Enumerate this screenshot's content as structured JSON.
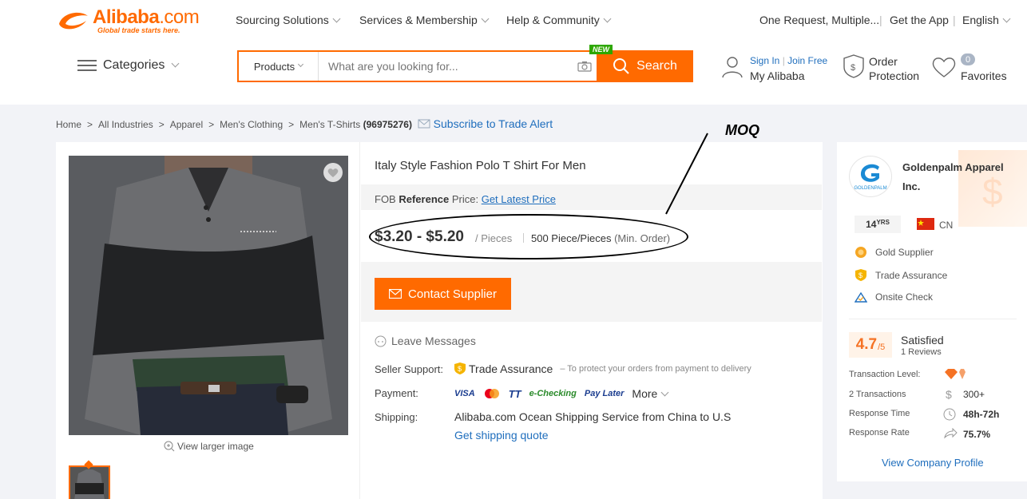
{
  "header": {
    "logo_word": "Alibaba",
    "logo_dotcom": ".com",
    "logo_tagline": "Global trade starts here.",
    "nav": [
      "Sourcing Solutions",
      "Services & Membership",
      "Help & Community"
    ],
    "one_request": "One Request, Multiple...",
    "get_app": "Get the App",
    "language": "English",
    "categories_label": "Categories",
    "search": {
      "category": "Products",
      "placeholder": "What are you looking for...",
      "button_label": "Search",
      "new_badge": "NEW"
    },
    "sign_in": "Sign In",
    "join_free": "Join Free",
    "my_alibaba": "My Alibaba",
    "order_protection_line1": "Order",
    "order_protection_line2": "Protection",
    "favorites_count": "0",
    "favorites_label": "Favorites"
  },
  "breadcrumb": {
    "items": [
      "Home",
      "All Industries",
      "Apparel",
      "Men's Clothing",
      "Men's T-Shirts"
    ],
    "count": "(96975276)",
    "subscribe": "Subscribe to Trade Alert"
  },
  "product": {
    "title": "Italy Style Fashion Polo T Shirt For Men",
    "fob_prefix": "FOB",
    "fob_bold": "Reference",
    "fob_suffix": "Price:",
    "get_latest_price": "Get Latest Price",
    "price_range": "$3.20 - $5.20",
    "price_unit": "/ Pieces",
    "moq_value": "500 Piece/Pieces",
    "moq_label": "(Min. Order)",
    "contact_button": "Contact Supplier",
    "leave_messages": "Leave Messages",
    "seller_support_label": "Seller Support:",
    "trade_assurance": "Trade Assurance",
    "trade_assurance_note": "– To protect your orders from payment to delivery",
    "payment_label": "Payment:",
    "payment_methods": [
      "VISA",
      "TT",
      "e-Checking",
      "Pay Later"
    ],
    "payment_more": "More",
    "shipping_label": "Shipping:",
    "shipping_service": "Alibaba.com Ocean Shipping Service from China to U.S",
    "shipping_quote": "Get shipping quote",
    "view_larger": "View larger image"
  },
  "annotation": {
    "label": "MOQ"
  },
  "supplier": {
    "name": "Goldenpalm Apparel Inc.",
    "logo_text": "GOLDENPALM",
    "years_num": "14",
    "years_unit": "YRS",
    "country": "CN",
    "badges": [
      "Gold Supplier",
      "Trade Assurance",
      "Onsite Check"
    ],
    "rating": "4.7",
    "rating_max": "/5",
    "satisfied": "Satisfied",
    "reviews": "1 Reviews",
    "stats": [
      {
        "label": "Transaction Level:",
        "value": ""
      },
      {
        "label": "2 Transactions",
        "value": "300+"
      },
      {
        "label": "Response Time",
        "value": "48h-72h"
      },
      {
        "label": "Response Rate",
        "value": "75.7%"
      }
    ],
    "view_profile": "View Company Profile"
  },
  "colors": {
    "brand_orange": "#ff6a00",
    "link_blue": "#1f6ebd",
    "new_green": "#2ea700"
  }
}
